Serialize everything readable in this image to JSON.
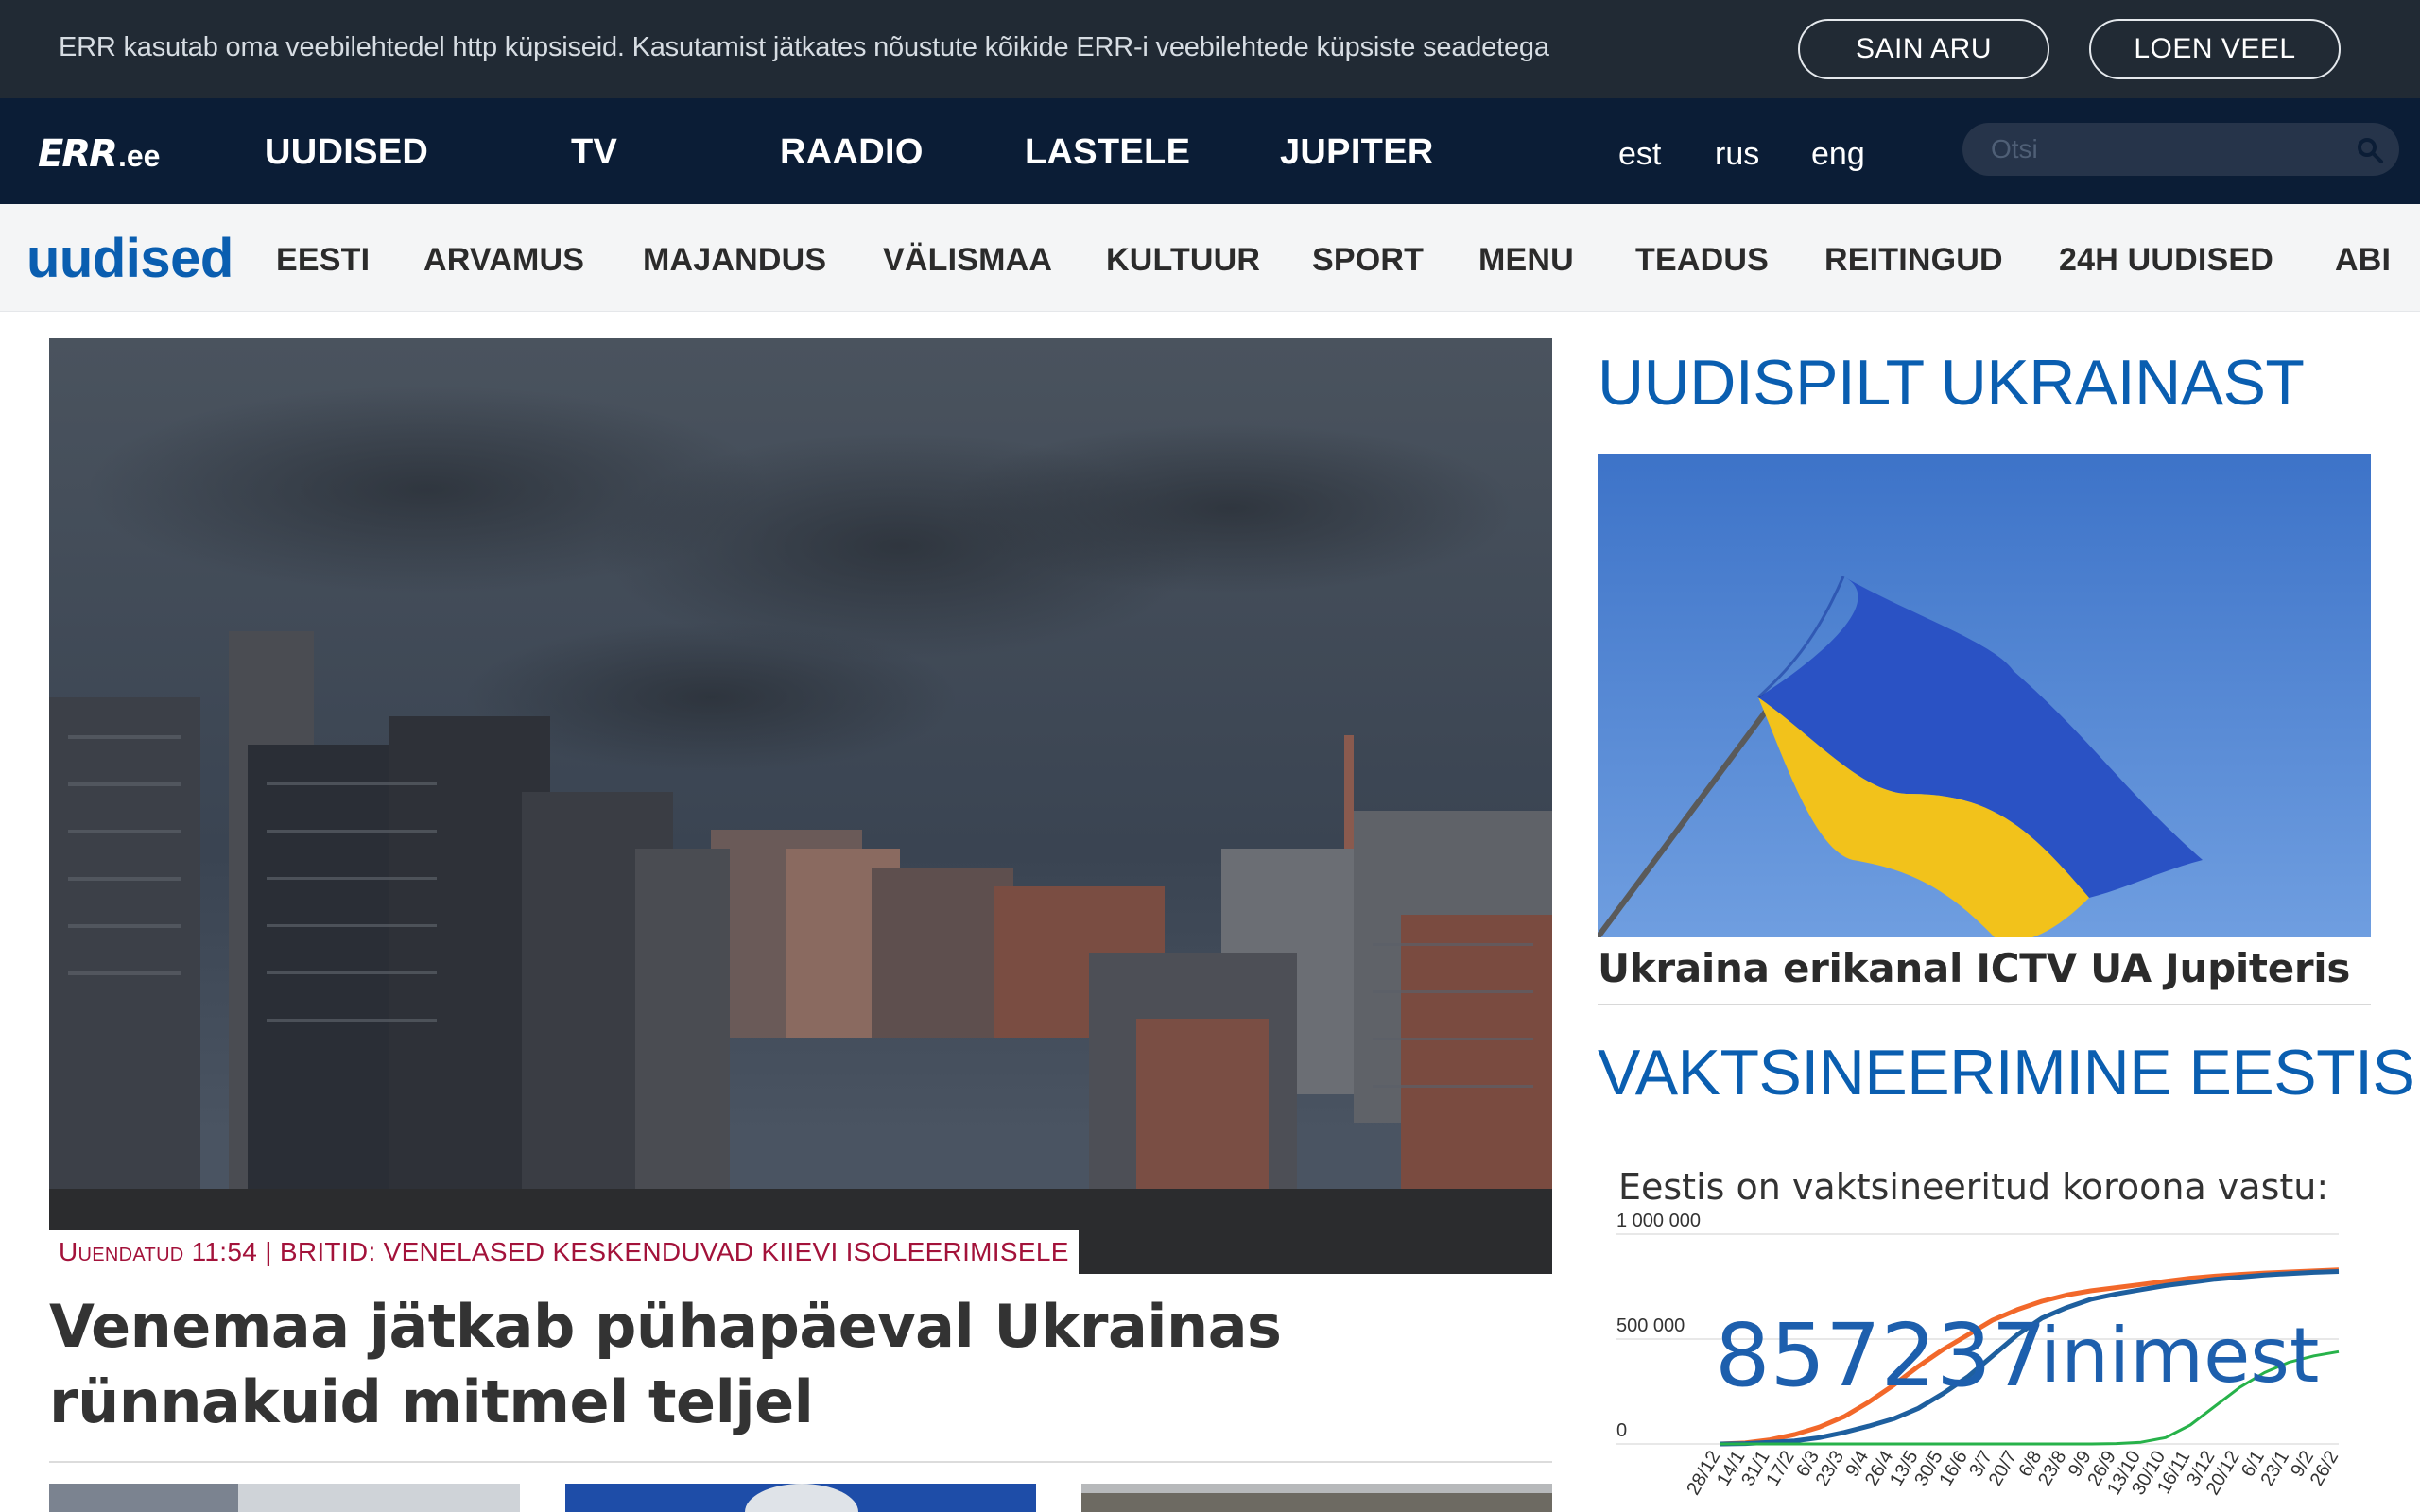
{
  "cookie_bar": {
    "text": "ERR kasutab oma veebilehtedel http küpsiseid. Kasutamist jätkates nõustute kõikide ERR-i veebilehtede küpsiste seadetega",
    "accept_label": "SAIN ARU",
    "more_label": "LOEN VEEL"
  },
  "main_nav": {
    "logo_main": "ERR",
    "logo_suffix": ".ee",
    "items": [
      "UUDISED",
      "TV",
      "RAADIO",
      "LASTELE",
      "JUPITER"
    ],
    "languages": [
      "est",
      "rus",
      "eng"
    ],
    "search_placeholder": "Otsi",
    "search_icon": "search-icon"
  },
  "sub_nav": {
    "section": "uudised",
    "items": [
      "EESTI",
      "ARVAMUS",
      "MAJANDUS",
      "VÄLISMAA",
      "KULTUUR",
      "SPORT",
      "MENU",
      "TEADUS",
      "REITINGUD",
      "24H UUDISED",
      "ABI"
    ]
  },
  "hero": {
    "tag_updated": "Uuendatud 11:54",
    "tag_separator": " | ",
    "tag_headline": "BRITID: VENELASED KESKENDUVAD KIIEVI ISOLEERIMISELE",
    "title": "Venemaa jätkab pühapäeval Ukrainas rünnakuid mitmel teljel"
  },
  "sidebar": {
    "ukraine_heading": "UUDISPILT UKRAINAST",
    "ukraine_caption": "Ukraina erikanal ICTV UA Jupiteris",
    "vax_heading": "VAKTSINEERIMINE EESTIS",
    "vax_intro": "Eestis on vaktsineeritud koroona vastu:",
    "vax_count": "857237",
    "vax_unit": "inimest"
  },
  "chart_data": {
    "type": "line",
    "title": "",
    "xlabel": "",
    "ylabel": "",
    "ylim": [
      0,
      1000000
    ],
    "ytick_labels": [
      "1 000 000",
      "500 000",
      "0"
    ],
    "yticks": [
      1000000,
      500000,
      0
    ],
    "categories": [
      "28/12",
      "14/1",
      "31/1",
      "17/2",
      "6/3",
      "23/3",
      "9/4",
      "26/4",
      "13/5",
      "30/5",
      "16/6",
      "3/7",
      "20/7",
      "6/8",
      "23/8",
      "9/9",
      "26/9",
      "13/10",
      "30/10",
      "16/11",
      "3/12",
      "20/12",
      "6/1",
      "23/1",
      "9/2",
      "26/2"
    ],
    "series": [
      {
        "color": "#f2682a",
        "values": [
          0,
          5000,
          20000,
          45000,
          80000,
          130000,
          200000,
          280000,
          370000,
          450000,
          520000,
          590000,
          640000,
          680000,
          710000,
          730000,
          745000,
          760000,
          775000,
          790000,
          800000,
          808000,
          815000,
          820000,
          825000,
          830000
        ]
      },
      {
        "color": "#1e5f9e",
        "values": [
          0,
          2000,
          8000,
          15000,
          30000,
          55000,
          85000,
          120000,
          170000,
          240000,
          320000,
          420000,
          520000,
          600000,
          650000,
          690000,
          715000,
          735000,
          755000,
          770000,
          785000,
          795000,
          805000,
          812000,
          818000,
          822000
        ]
      },
      {
        "color": "#27b24a",
        "values": [
          0,
          0,
          0,
          0,
          0,
          0,
          0,
          0,
          0,
          0,
          0,
          0,
          0,
          0,
          0,
          0,
          2000,
          8000,
          30000,
          90000,
          180000,
          270000,
          340000,
          390000,
          420000,
          440000
        ]
      }
    ],
    "grid": true
  }
}
